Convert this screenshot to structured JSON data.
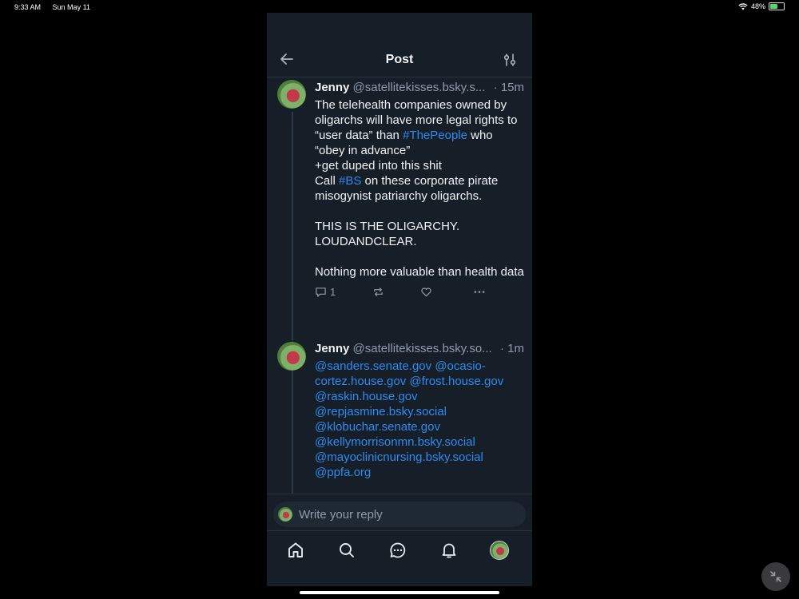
{
  "status_bar": {
    "time": "9:33 AM",
    "date": "Sun May 11",
    "battery": "48%",
    "battery_level": 0.48
  },
  "header": {
    "title": "Post",
    "back_icon": "arrow-left-icon",
    "filter_icon": "sliders-icon"
  },
  "posts": [
    {
      "author": "Jenny",
      "handle": "@satellitekisses.bsky.s...",
      "time": "· 15m",
      "segments": [
        {
          "t": "The telehealth companies owned by oligarchs will have more legal rights to\n“user data” than "
        },
        {
          "t": "#ThePeople",
          "link": true
        },
        {
          "t": " who\n“obey in advance”\n+get duped into this shit\nCall "
        },
        {
          "t": "#BS",
          "link": true
        },
        {
          "t": " on these corporate pirate misogynist patriarchy oligarchs.\n\nTHIS IS THE OLIGARCHY.\nLOUDANDCLEAR.\n\nNothing more valuable than health data"
        }
      ],
      "reply_count": "1"
    },
    {
      "author": "Jenny",
      "handle": "@satellitekisses.bsky.so...",
      "time": "· 1m",
      "segments": [
        {
          "t": "@sanders.senate.gov @ocasio-cortez.house.gov @frost.house.gov\n@raskin.house.gov\n@repjasmine.bsky.social\n@klobuchar.senate.gov\n@kellymorrisonmn.bsky.social\n@mayoclinicnursing.bsky.social\n@ppfa.org",
          "link": true
        }
      ]
    }
  ],
  "reply": {
    "placeholder": "Write your reply"
  },
  "tabs": [
    "home-icon",
    "search-icon",
    "chat-icon",
    "bell-icon",
    "profile-avatar"
  ],
  "colors": {
    "background": "#161e27",
    "link": "#2f8bf0",
    "muted": "#8f9cab"
  }
}
